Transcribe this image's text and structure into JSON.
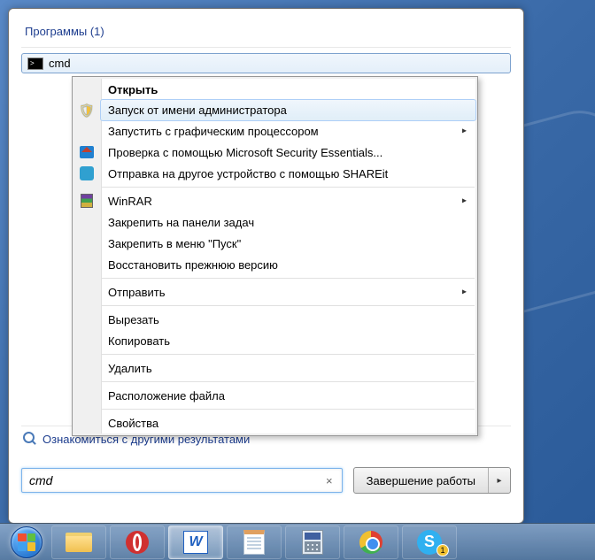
{
  "start": {
    "section_header": "Программы (1)",
    "result_label": "cmd",
    "see_more": "Ознакомиться с другими результатами",
    "search_value": "cmd",
    "shutdown_label": "Завершение работы"
  },
  "context_menu": {
    "open": "Открыть",
    "run_as_admin": "Запуск от имени администратора",
    "run_gpu": "Запустить с графическим процессором",
    "mse_scan": "Проверка с помощью Microsoft Security Essentials...",
    "shareit": "Отправка на другое устройство с помощью SHAREit",
    "winrar": "WinRAR",
    "pin_taskbar": "Закрепить на панели задач",
    "pin_start": "Закрепить в меню \"Пуск\"",
    "restore_prev": "Восстановить прежнюю версию",
    "send_to": "Отправить",
    "cut": "Вырезать",
    "copy": "Копировать",
    "delete": "Удалить",
    "file_location": "Расположение файла",
    "properties": "Свойства"
  },
  "taskbar": {
    "word_letter": "W",
    "skype_letter": "S",
    "skype_badge": "1"
  }
}
